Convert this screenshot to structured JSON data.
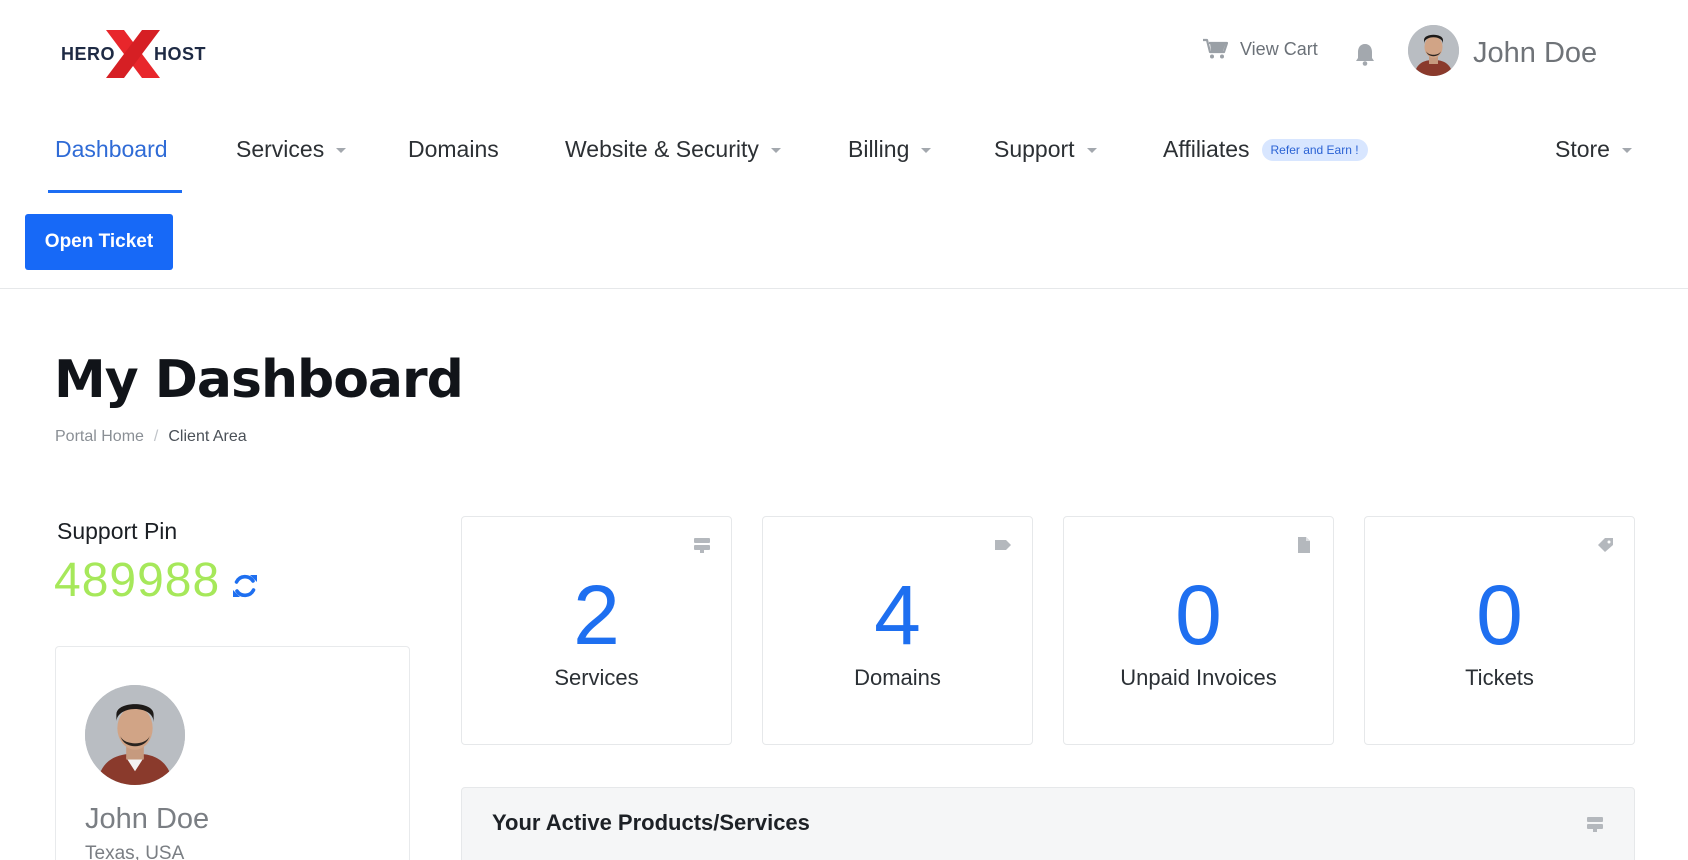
{
  "brand": {
    "left_text": "HERO",
    "right_text": "HOST",
    "accent_color": "#e8262b",
    "dark_color": "#1e2a44"
  },
  "header": {
    "cart_label": "View Cart",
    "user_name": "John Doe"
  },
  "nav": {
    "items": [
      {
        "label": "Dashboard",
        "active": true
      },
      {
        "label": "Services",
        "has_dropdown": true
      },
      {
        "label": "Domains"
      },
      {
        "label": "Website & Security",
        "has_dropdown": true
      },
      {
        "label": "Billing",
        "has_dropdown": true
      },
      {
        "label": "Support",
        "has_dropdown": true
      },
      {
        "label": "Affiliates",
        "badge": "Refer and Earn !"
      },
      {
        "label": "Store",
        "has_dropdown": true
      }
    ],
    "active_color": "#1d6df3"
  },
  "actions": {
    "open_ticket_label": "Open Ticket"
  },
  "page": {
    "title": "My Dashboard",
    "breadcrumb": {
      "home": "Portal Home",
      "separator": "/",
      "current": "Client Area"
    }
  },
  "support_pin": {
    "label": "Support Pin",
    "value": "489988",
    "color": "#a6e85a"
  },
  "profile": {
    "name": "John Doe",
    "location": "Texas, USA"
  },
  "stats": [
    {
      "value": "2",
      "label": "Services",
      "icon": "server-icon"
    },
    {
      "value": "4",
      "label": "Domains",
      "icon": "tag-icon"
    },
    {
      "value": "0",
      "label": "Unpaid Invoices",
      "icon": "document-icon"
    },
    {
      "value": "0",
      "label": "Tickets",
      "icon": "ticket-icon"
    }
  ],
  "active_products": {
    "title": "Your Active Products/Services",
    "icon": "server-icon"
  }
}
